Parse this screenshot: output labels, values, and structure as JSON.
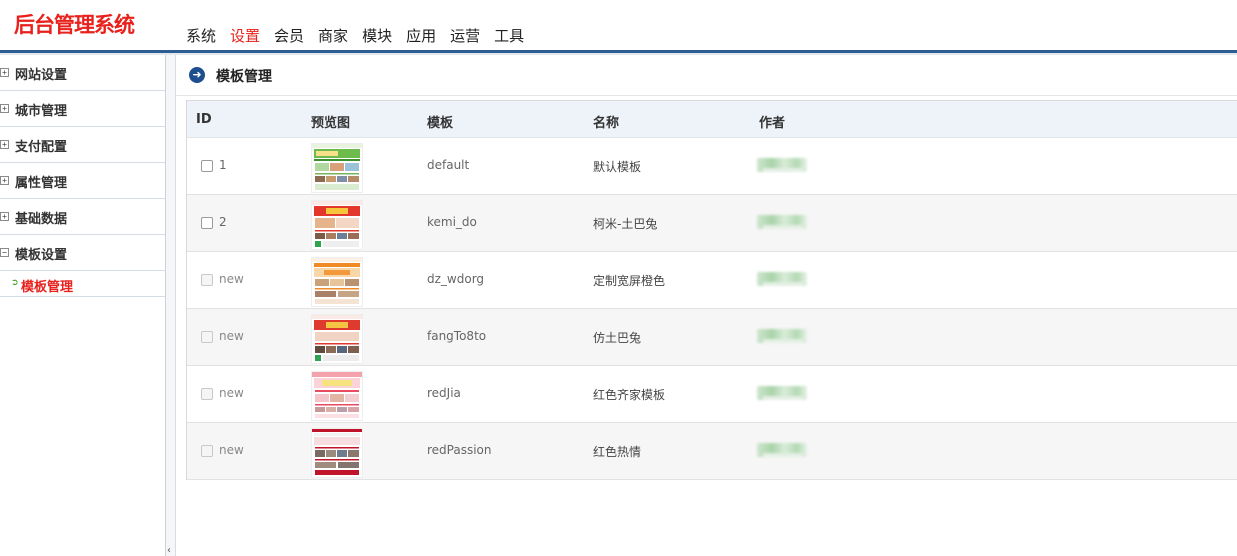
{
  "app": {
    "logo_text": "后台管理系统"
  },
  "topnav": {
    "items": [
      {
        "label": "系统",
        "active": false
      },
      {
        "label": "设置",
        "active": true
      },
      {
        "label": "会员",
        "active": false
      },
      {
        "label": "商家",
        "active": false
      },
      {
        "label": "模块",
        "active": false
      },
      {
        "label": "应用",
        "active": false
      },
      {
        "label": "运营",
        "active": false
      },
      {
        "label": "工具",
        "active": false
      }
    ],
    "active_color": "#e8211c"
  },
  "sidebar": {
    "groups": [
      {
        "label": "网站设置",
        "expanded": false
      },
      {
        "label": "城市管理",
        "expanded": false
      },
      {
        "label": "支付配置",
        "expanded": false
      },
      {
        "label": "属性管理",
        "expanded": false
      },
      {
        "label": "基础数据",
        "expanded": false
      },
      {
        "label": "模板设置",
        "expanded": true
      }
    ],
    "sub_items": [
      {
        "label": "模板管理",
        "active": true
      }
    ],
    "collapse_glyph": "‹"
  },
  "main": {
    "title": "模板管理",
    "title_icon": "arrow-right-circle-icon",
    "table": {
      "headers": {
        "id": "ID",
        "preview": "预览图",
        "template": "模板",
        "name": "名称",
        "author": "作者"
      },
      "rows": [
        {
          "id": "1",
          "installed": true,
          "template": "default",
          "name": "默认模板",
          "thumb_theme": "green"
        },
        {
          "id": "2",
          "installed": true,
          "template": "kemi_do",
          "name": "柯米-土巴兔",
          "thumb_theme": "red"
        },
        {
          "id": "new",
          "installed": false,
          "template": "dz_wdorg",
          "name": "定制宽屏橙色",
          "thumb_theme": "orange"
        },
        {
          "id": "new",
          "installed": false,
          "template": "fangTo8to",
          "name": "仿土巴兔",
          "thumb_theme": "red"
        },
        {
          "id": "new",
          "installed": false,
          "template": "redJia",
          "name": "红色齐家模板",
          "thumb_theme": "pink"
        },
        {
          "id": "new",
          "installed": false,
          "template": "redPassion",
          "name": "红色热情",
          "thumb_theme": "darkred"
        }
      ]
    }
  }
}
